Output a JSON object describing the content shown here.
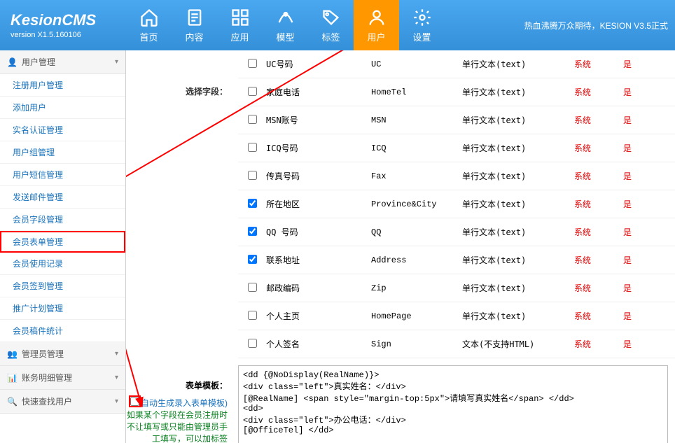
{
  "header": {
    "logo_title": "KesionCMS",
    "logo_version": "version X1.5.160106",
    "nav_tabs": [
      {
        "label": "首页",
        "icon": "home-icon"
      },
      {
        "label": "内容",
        "icon": "content-icon"
      },
      {
        "label": "应用",
        "icon": "apps-icon"
      },
      {
        "label": "模型",
        "icon": "model-icon"
      },
      {
        "label": "标签",
        "icon": "tag-icon"
      },
      {
        "label": "用户",
        "icon": "user-icon",
        "active": true
      },
      {
        "label": "设置",
        "icon": "settings-icon"
      }
    ],
    "right_text": "热血沸腾万众期待，KESION V3.5正式"
  },
  "sidebar": {
    "groups": [
      {
        "title": "用户管理",
        "icon": "user-icon",
        "expanded": true,
        "items": [
          {
            "label": "注册用户管理"
          },
          {
            "label": "添加用户"
          },
          {
            "label": "实名认证管理"
          },
          {
            "label": "用户组管理"
          },
          {
            "label": "用户短信管理"
          },
          {
            "label": "发送邮件管理"
          },
          {
            "label": "会员字段管理"
          },
          {
            "label": "会员表单管理",
            "highlighted": true
          },
          {
            "label": "会员使用记录"
          },
          {
            "label": "会员签到管理"
          },
          {
            "label": "推广计划管理"
          },
          {
            "label": "会员稿件统计"
          }
        ]
      },
      {
        "title": "管理员管理",
        "icon": "admin-icon",
        "expanded": false
      },
      {
        "title": "账务明细管理",
        "icon": "finance-icon",
        "expanded": false
      },
      {
        "title": "快速查找用户",
        "icon": "search-icon",
        "expanded": false
      }
    ]
  },
  "content": {
    "select_fields_label": "选择字段：",
    "fields": [
      {
        "checked": false,
        "name": "UC号码",
        "code": "UC",
        "type": "单行文本(text)",
        "sys": "系统",
        "req": "是"
      },
      {
        "checked": false,
        "name": "家庭电话",
        "code": "HomeTel",
        "type": "单行文本(text)",
        "sys": "系统",
        "req": "是"
      },
      {
        "checked": false,
        "name": "MSN账号",
        "code": "MSN",
        "type": "单行文本(text)",
        "sys": "系统",
        "req": "是"
      },
      {
        "checked": false,
        "name": "ICQ号码",
        "code": "ICQ",
        "type": "单行文本(text)",
        "sys": "系统",
        "req": "是"
      },
      {
        "checked": false,
        "name": "传真号码",
        "code": "Fax",
        "type": "单行文本(text)",
        "sys": "系统",
        "req": "是"
      },
      {
        "checked": true,
        "name": "所在地区",
        "code": "Province&City",
        "type": "单行文本(text)",
        "sys": "系统",
        "req": "是"
      },
      {
        "checked": true,
        "name": "QQ 号码",
        "code": "QQ",
        "type": "单行文本(text)",
        "sys": "系统",
        "req": "是"
      },
      {
        "checked": true,
        "name": "联系地址",
        "code": "Address",
        "type": "单行文本(text)",
        "sys": "系统",
        "req": "是"
      },
      {
        "checked": false,
        "name": "邮政编码",
        "code": "Zip",
        "type": "单行文本(text)",
        "sys": "系统",
        "req": "是"
      },
      {
        "checked": false,
        "name": "个人主页",
        "code": "HomePage",
        "type": "单行文本(text)",
        "sys": "系统",
        "req": "是"
      },
      {
        "checked": false,
        "name": "个人签名",
        "code": "Sign",
        "type": "文本(不支持HTML)",
        "sys": "系统",
        "req": "是"
      }
    ],
    "template_label": "表单模板：",
    "auto_generate_label": "自动生成录入表单模板)",
    "template_hint_green": "如果某个字段在会员注册时不让填写或只能由管理员手工填写，可以加标签",
    "template_code_lines": [
      "<dd {@NoDisplay(RealName)}>",
      "  <div class=\"left\">真实姓名：</div>",
      "  [@RealName] <span style=\"margin-top:5px\">请填写真实姓名</span> </dd>",
      "<dd>",
      "  <div class=\"left\">办公电话：</div>",
      "  [@OfficeTel] </dd>"
    ]
  }
}
